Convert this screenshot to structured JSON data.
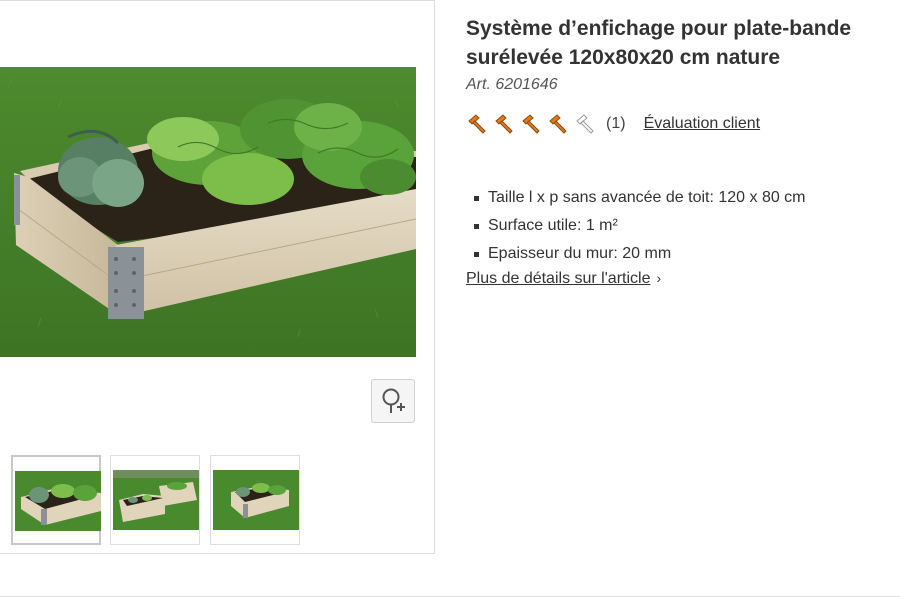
{
  "product": {
    "title_line1": "Système d’enfichage pour plate-bande",
    "title_line2": "surélevée 120x80x20 cm nature",
    "article": "Art. 6201646"
  },
  "rating": {
    "filled": 4,
    "total": 5,
    "count": "(1)",
    "link": "Évaluation client",
    "icon": "hammer-icon",
    "filled_color": "#e07b1a",
    "empty_color": "#999999"
  },
  "features": [
    "Taille l x p sans avancée de toit: 120 x 80 cm",
    "Surface utile: 1 m²",
    "Epaisseur du mur: 20 mm"
  ],
  "more_details": "Plus de détails sur l'article",
  "gallery": {
    "zoom_icon": "zoom-in-icon",
    "thumbnails": 3,
    "active_thumbnail": 1
  }
}
